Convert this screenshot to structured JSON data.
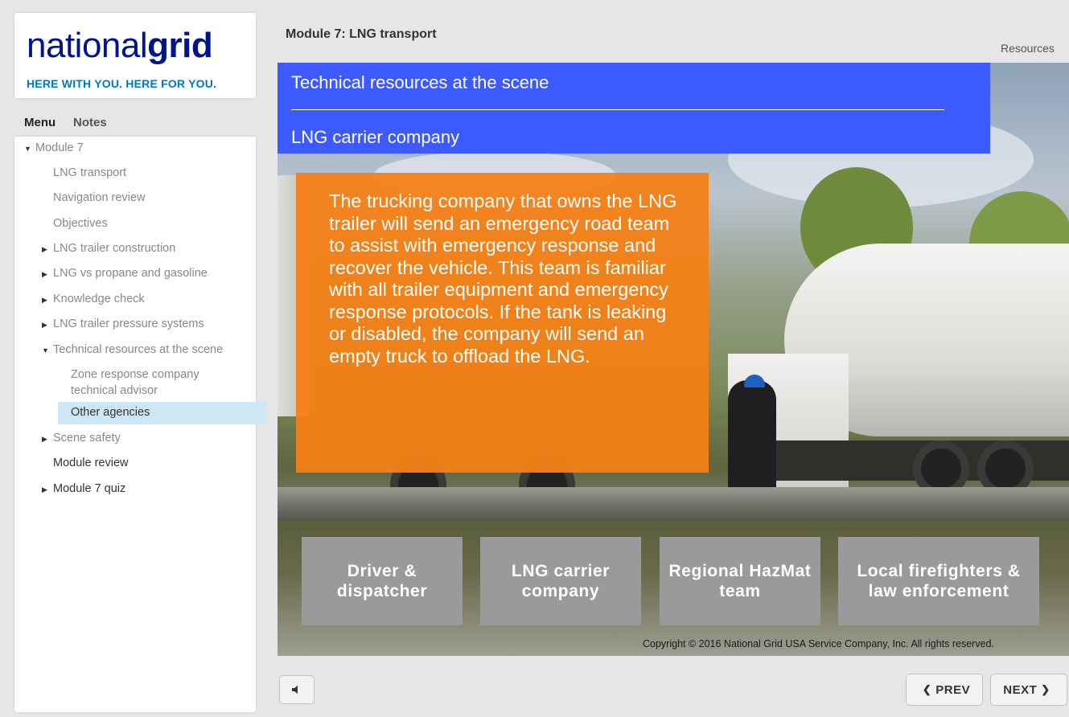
{
  "brand": {
    "name_light": "national",
    "name_bold": "grid",
    "tagline": "HERE WITH YOU. HERE FOR YOU."
  },
  "sidebar": {
    "tabs": [
      {
        "label": "Menu",
        "active": true
      },
      {
        "label": "Notes",
        "active": false
      }
    ],
    "items": [
      {
        "label": "Module 7",
        "icon": "triangle-down-icon"
      },
      {
        "label": "LNG transport"
      },
      {
        "label": "Navigation review"
      },
      {
        "label": "Objectives"
      },
      {
        "label": "LNG trailer construction",
        "icon": "triangle-right-icon"
      },
      {
        "label": "LNG vs propane and gasoline",
        "icon": "triangle-right-icon"
      },
      {
        "label": "Knowledge check",
        "icon": "triangle-right-icon"
      },
      {
        "label": "LNG trailer pressure systems",
        "icon": "triangle-right-icon"
      },
      {
        "label": "Technical resources at the scene",
        "icon": "triangle-down-icon"
      },
      {
        "label": "Zone response company"
      },
      {
        "label": "technical advisor"
      },
      {
        "label": "Other agencies",
        "selected": true
      },
      {
        "label": "Scene safety",
        "icon": "triangle-right-icon"
      },
      {
        "label": "Module review"
      },
      {
        "label": "Module 7 quiz",
        "icon": "triangle-right-icon"
      }
    ],
    "highlight_color": "#cde7f4"
  },
  "header": {
    "module_title": "Module 7: LNG transport",
    "resources_label": "Resources"
  },
  "slide": {
    "title": "Technical resources at the scene",
    "subtitle": "LNG carrier company",
    "title_bar_color": "#3d5afe",
    "body_text": "The trucking company that owns the LNG trailer will send an emergency road team to assist with emergency response and recover the vehicle. This team is familiar with all trailer equipment and emergency response protocols. If the tank is leaking or disabled, the company will send an empty truck to offload the LNG.",
    "body_box_color": "#f58014",
    "buttons": [
      {
        "label": "Driver & dispatcher"
      },
      {
        "label": "LNG carrier company"
      },
      {
        "label": "Regional HazMat team"
      },
      {
        "label": "Local firefighters & law enforcement"
      }
    ],
    "copyright": "Copyright © 2016 National Grid USA Service Company, Inc. All rights reserved."
  },
  "controls": {
    "volume_icon": "speaker-icon",
    "prev_label": "PREV",
    "next_label": "NEXT"
  }
}
